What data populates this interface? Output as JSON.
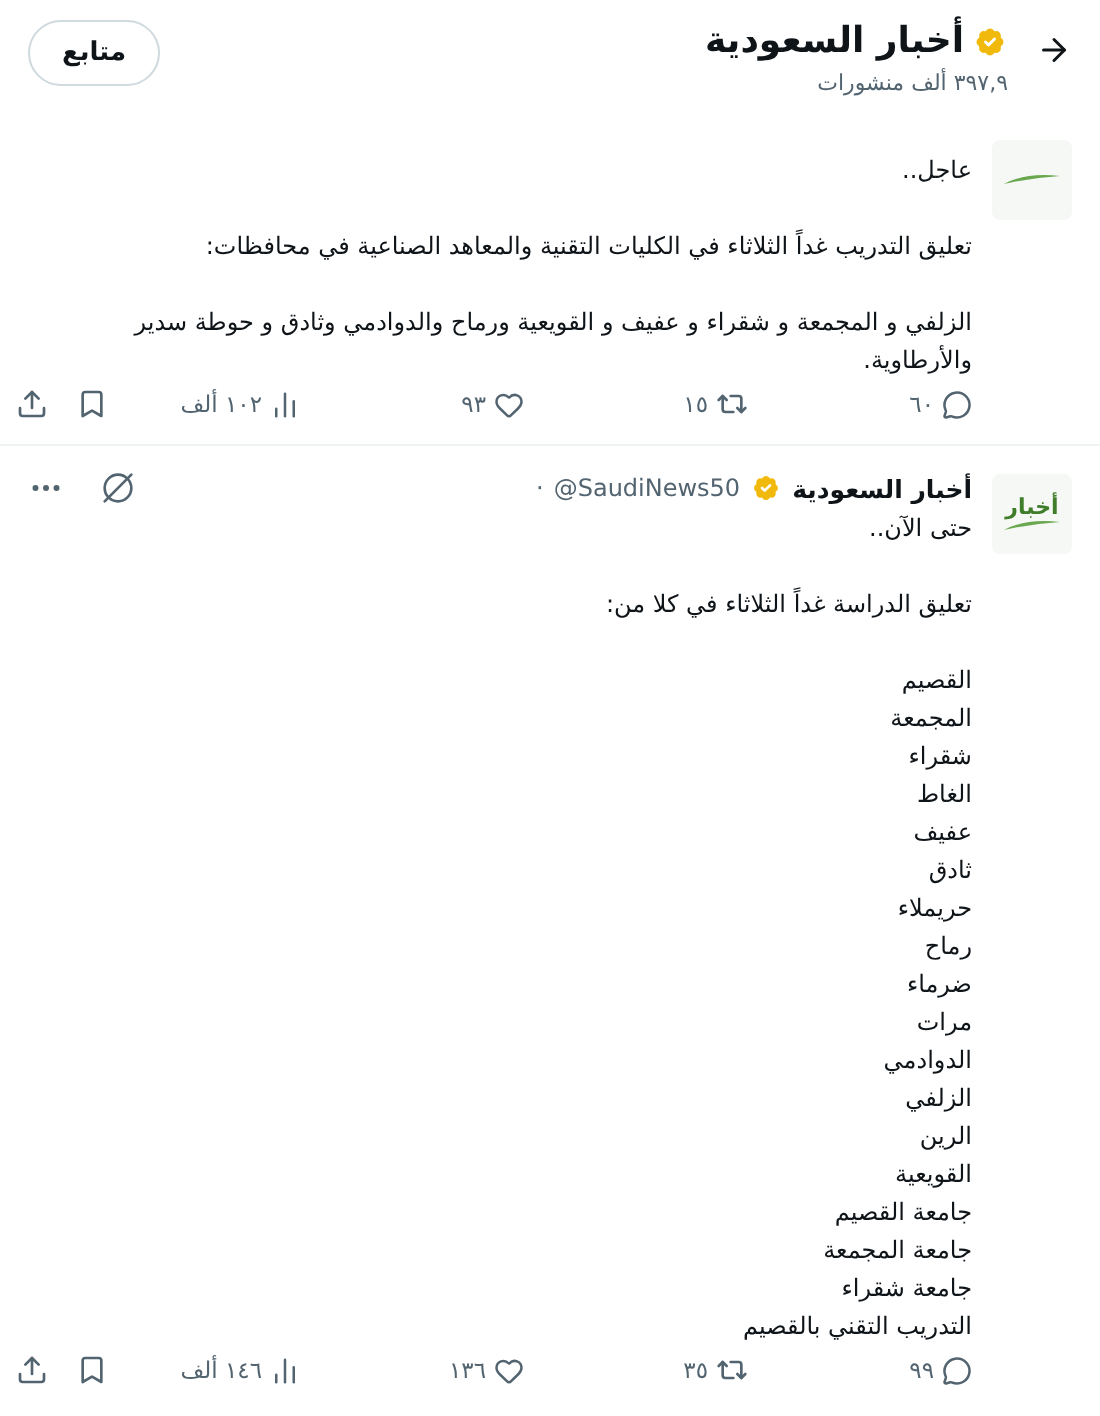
{
  "header": {
    "title": "أخبار السعودية",
    "verified": true,
    "subtitle": "٣٩٧,٩ ألف منشورات",
    "follow_button": "متابع"
  },
  "posts": [
    {
      "paragraphs": [
        [
          "عاجل.."
        ],
        [
          "تعليق التدريب غداً الثلاثاء في الكليات التقنية والمعاهد الصناعية في محافظات:"
        ],
        [
          "الزلفي و المجمعة و شقراء و عفيف و  القويعية ورماح والدوادمي وثادق و حوطة سدير والأرطاوية."
        ]
      ],
      "stats": {
        "replies": "٦٠",
        "reposts": "١٥",
        "likes": "٩٣",
        "views": "١٠٢ ألف"
      }
    },
    {
      "avatar_text": "أخبار",
      "author": "أخبار السعودية",
      "verified": true,
      "handle": "@SaudiNews50",
      "separator": "·",
      "paragraphs": [
        [
          "حتى الآن.."
        ],
        [
          "تعليق الدراسة غداً الثلاثاء في كلا من:"
        ],
        [
          "القصيم",
          "المجمعة",
          "شقراء",
          "الغاط",
          "عفيف",
          "ثادق",
          "حريملاء",
          "رماح",
          "ضرماء",
          "مرات",
          "الدوادمي",
          "الزلفي",
          "الرين",
          "القويعية",
          "جامعة القصيم",
          "جامعة المجمعة",
          "جامعة شقراء",
          "التدريب التقني بالقصيم"
        ]
      ],
      "stats": {
        "replies": "٩٩",
        "reposts": "٣٥",
        "likes": "١٣٦",
        "views": "١٤٦ ألف"
      }
    }
  ]
}
